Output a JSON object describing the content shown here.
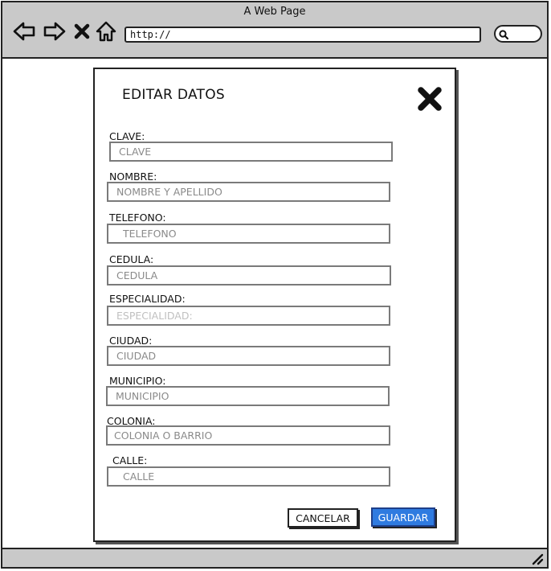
{
  "browser": {
    "title": "A Web Page",
    "url": "http://",
    "icons": [
      "back-icon",
      "forward-icon",
      "stop-icon",
      "home-icon",
      "search-icon",
      "resize-grip-icon"
    ]
  },
  "dialog": {
    "title": "EDITAR DATOS",
    "close_icon": "close-icon",
    "fields": [
      {
        "label": "CLAVE:",
        "placeholder": "CLAVE"
      },
      {
        "label": "NOMBRE:",
        "placeholder": "NOMBRE Y APELLIDO"
      },
      {
        "label": "TELEFONO:",
        "placeholder": "TELEFONO"
      },
      {
        "label": "CEDULA:",
        "placeholder": "CEDULA"
      },
      {
        "label": "ESPECIALIDAD:",
        "placeholder": "ESPECIALIDAD:"
      },
      {
        "label": "CIUDAD:",
        "placeholder": "CIUDAD"
      },
      {
        "label": "MUNICIPIO:",
        "placeholder": "MUNICIPIO"
      },
      {
        "label": "COLONIA:",
        "placeholder": "COLONIA O BARRIO"
      },
      {
        "label": "CALLE:",
        "placeholder": "CALLE"
      }
    ],
    "buttons": {
      "cancel": "CANCELAR",
      "save": "GUARDAR"
    },
    "colors": {
      "save_button": "#2f7be0"
    }
  }
}
